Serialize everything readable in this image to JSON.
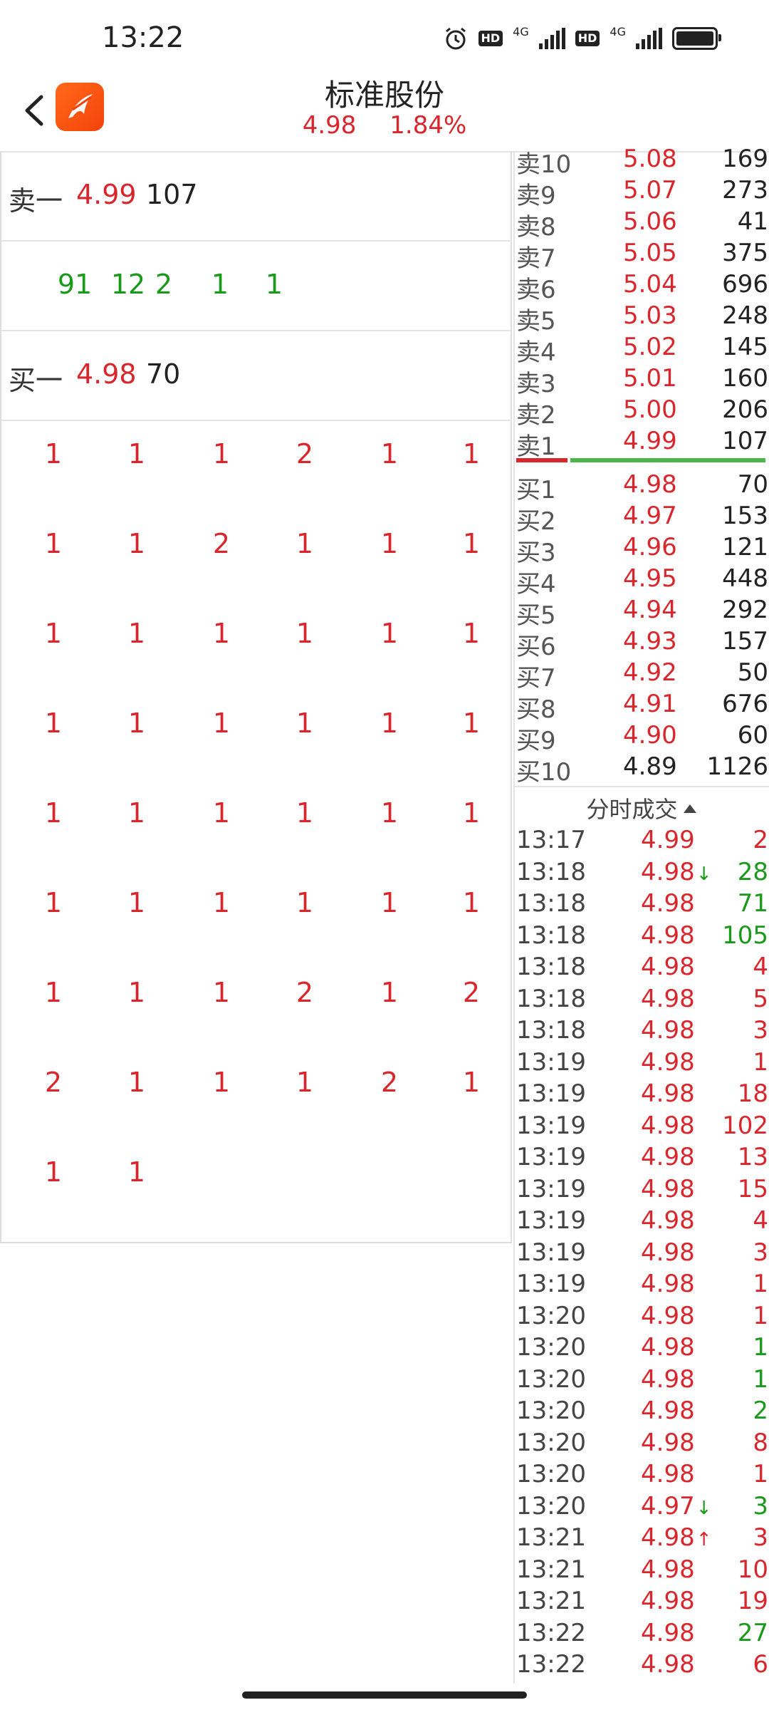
{
  "status_bar": {
    "time": "13:22",
    "net_label": "4G",
    "hd_label": "HD"
  },
  "header": {
    "title": "标准股份",
    "price": "4.98",
    "change_pct": "1.84%"
  },
  "left_panel": {
    "ask_label": "卖一",
    "ask_price": "4.99",
    "ask_volume": "107",
    "queue_counts": [
      "91",
      "12",
      "2",
      "1",
      "1"
    ],
    "bid_label": "买一",
    "bid_price": "4.98",
    "bid_volume": "70",
    "bid_queue_rows": [
      [
        "1",
        "1",
        "1",
        "2",
        "1",
        "1"
      ],
      [
        "1",
        "1",
        "2",
        "1",
        "1",
        "1"
      ],
      [
        "1",
        "1",
        "1",
        "1",
        "1",
        "1"
      ],
      [
        "1",
        "1",
        "1",
        "1",
        "1",
        "1"
      ],
      [
        "1",
        "1",
        "1",
        "1",
        "1",
        "1"
      ],
      [
        "1",
        "1",
        "1",
        "1",
        "1",
        "1"
      ],
      [
        "1",
        "1",
        "1",
        "2",
        "1",
        "2"
      ],
      [
        "2",
        "1",
        "1",
        "1",
        "2",
        "1"
      ],
      [
        "1",
        "1"
      ]
    ]
  },
  "order_book": {
    "asks": [
      {
        "label": "卖10",
        "price": "5.08",
        "volume": "169"
      },
      {
        "label": "卖9",
        "price": "5.07",
        "volume": "273"
      },
      {
        "label": "卖8",
        "price": "5.06",
        "volume": "41"
      },
      {
        "label": "卖7",
        "price": "5.05",
        "volume": "375"
      },
      {
        "label": "卖6",
        "price": "5.04",
        "volume": "696"
      },
      {
        "label": "卖5",
        "price": "5.03",
        "volume": "248"
      },
      {
        "label": "卖4",
        "price": "5.02",
        "volume": "145"
      },
      {
        "label": "卖3",
        "price": "5.01",
        "volume": "160"
      },
      {
        "label": "卖2",
        "price": "5.00",
        "volume": "206"
      },
      {
        "label": "卖1",
        "price": "4.99",
        "volume": "107"
      }
    ],
    "bids": [
      {
        "label": "买1",
        "price": "4.98",
        "volume": "70"
      },
      {
        "label": "买2",
        "price": "4.97",
        "volume": "153"
      },
      {
        "label": "买3",
        "price": "4.96",
        "volume": "121"
      },
      {
        "label": "买4",
        "price": "4.95",
        "volume": "448"
      },
      {
        "label": "买5",
        "price": "4.94",
        "volume": "292"
      },
      {
        "label": "买6",
        "price": "4.93",
        "volume": "157"
      },
      {
        "label": "买7",
        "price": "4.92",
        "volume": "50"
      },
      {
        "label": "买8",
        "price": "4.91",
        "volume": "676"
      },
      {
        "label": "买9",
        "price": "4.90",
        "volume": "60"
      },
      {
        "label": "买10",
        "price": "4.89",
        "volume": "1126"
      }
    ]
  },
  "trades": {
    "header": "分时成交",
    "rows": [
      {
        "time": "13:17",
        "price": "4.99",
        "arrow": "",
        "volume": "2",
        "side": "red"
      },
      {
        "time": "13:18",
        "price": "4.98",
        "arrow": "↓",
        "volume": "28",
        "side": "green"
      },
      {
        "time": "13:18",
        "price": "4.98",
        "arrow": "",
        "volume": "71",
        "side": "green"
      },
      {
        "time": "13:18",
        "price": "4.98",
        "arrow": "",
        "volume": "105",
        "side": "green"
      },
      {
        "time": "13:18",
        "price": "4.98",
        "arrow": "",
        "volume": "4",
        "side": "red"
      },
      {
        "time": "13:18",
        "price": "4.98",
        "arrow": "",
        "volume": "5",
        "side": "red"
      },
      {
        "time": "13:18",
        "price": "4.98",
        "arrow": "",
        "volume": "3",
        "side": "red"
      },
      {
        "time": "13:19",
        "price": "4.98",
        "arrow": "",
        "volume": "1",
        "side": "red"
      },
      {
        "time": "13:19",
        "price": "4.98",
        "arrow": "",
        "volume": "18",
        "side": "red"
      },
      {
        "time": "13:19",
        "price": "4.98",
        "arrow": "",
        "volume": "102",
        "side": "red"
      },
      {
        "time": "13:19",
        "price": "4.98",
        "arrow": "",
        "volume": "13",
        "side": "red"
      },
      {
        "time": "13:19",
        "price": "4.98",
        "arrow": "",
        "volume": "15",
        "side": "red"
      },
      {
        "time": "13:19",
        "price": "4.98",
        "arrow": "",
        "volume": "4",
        "side": "red"
      },
      {
        "time": "13:19",
        "price": "4.98",
        "arrow": "",
        "volume": "3",
        "side": "red"
      },
      {
        "time": "13:19",
        "price": "4.98",
        "arrow": "",
        "volume": "1",
        "side": "red"
      },
      {
        "time": "13:20",
        "price": "4.98",
        "arrow": "",
        "volume": "1",
        "side": "red"
      },
      {
        "time": "13:20",
        "price": "4.98",
        "arrow": "",
        "volume": "1",
        "side": "green"
      },
      {
        "time": "13:20",
        "price": "4.98",
        "arrow": "",
        "volume": "1",
        "side": "green"
      },
      {
        "time": "13:20",
        "price": "4.98",
        "arrow": "",
        "volume": "2",
        "side": "green"
      },
      {
        "time": "13:20",
        "price": "4.98",
        "arrow": "",
        "volume": "8",
        "side": "red"
      },
      {
        "time": "13:20",
        "price": "4.98",
        "arrow": "",
        "volume": "1",
        "side": "red"
      },
      {
        "time": "13:20",
        "price": "4.97",
        "arrow": "↓",
        "volume": "3",
        "side": "green"
      },
      {
        "time": "13:21",
        "price": "4.98",
        "arrow": "↑",
        "volume": "3",
        "side": "red"
      },
      {
        "time": "13:21",
        "price": "4.98",
        "arrow": "",
        "volume": "10",
        "side": "red"
      },
      {
        "time": "13:21",
        "price": "4.98",
        "arrow": "",
        "volume": "19",
        "side": "red"
      },
      {
        "time": "13:22",
        "price": "4.98",
        "arrow": "",
        "volume": "27",
        "side": "green"
      },
      {
        "time": "13:22",
        "price": "4.98",
        "arrow": "",
        "volume": "6",
        "side": "red"
      }
    ]
  },
  "colors": {
    "up": "#d9262c",
    "down": "#1a9a1a",
    "brand": "#f4520f"
  }
}
